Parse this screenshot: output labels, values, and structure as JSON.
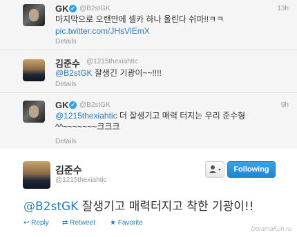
{
  "tweets": [
    {
      "name": "GK",
      "handle": "@B2stGK",
      "time": "13h",
      "text": "마지막으로 오랜만에 셀카 하나 올린다 쉬마!!ㅋㅋ",
      "link": "pic.twitter.com/JHsVlEmX",
      "details": "Details",
      "verified": true
    },
    {
      "name": "김준수",
      "handle": "@1215thexiahtic",
      "mention": "@B2stGK",
      "text": " 잘생긴 기광이~~!!!!",
      "details": "Details"
    },
    {
      "name": "GK",
      "handle": "@B2stGK",
      "time": "9h",
      "mention": "@1215thexiahtic",
      "text": " 더 잘생기고 매력 터지는 우리 준수형",
      "text2": "^^~~~~~~~크크크",
      "details": "Details",
      "verified": true
    }
  ],
  "main": {
    "name": "김준수",
    "handle": "@1215thexiahtic",
    "follow_label": "Following",
    "mention": "@B2stGK",
    "text": " 잘생기고 매력터지고 착한 기광이!!",
    "actions": [
      "Reply",
      "Retweet",
      "Favorite"
    ]
  },
  "watermark": "DoramaKun.ru",
  "colors": {
    "link": "#2b7bb9",
    "follow": "#1f86d3"
  },
  "icons": [
    "verified-icon",
    "user-dropdown-icon",
    "reply-icon",
    "retweet-icon",
    "favorite-icon"
  ]
}
